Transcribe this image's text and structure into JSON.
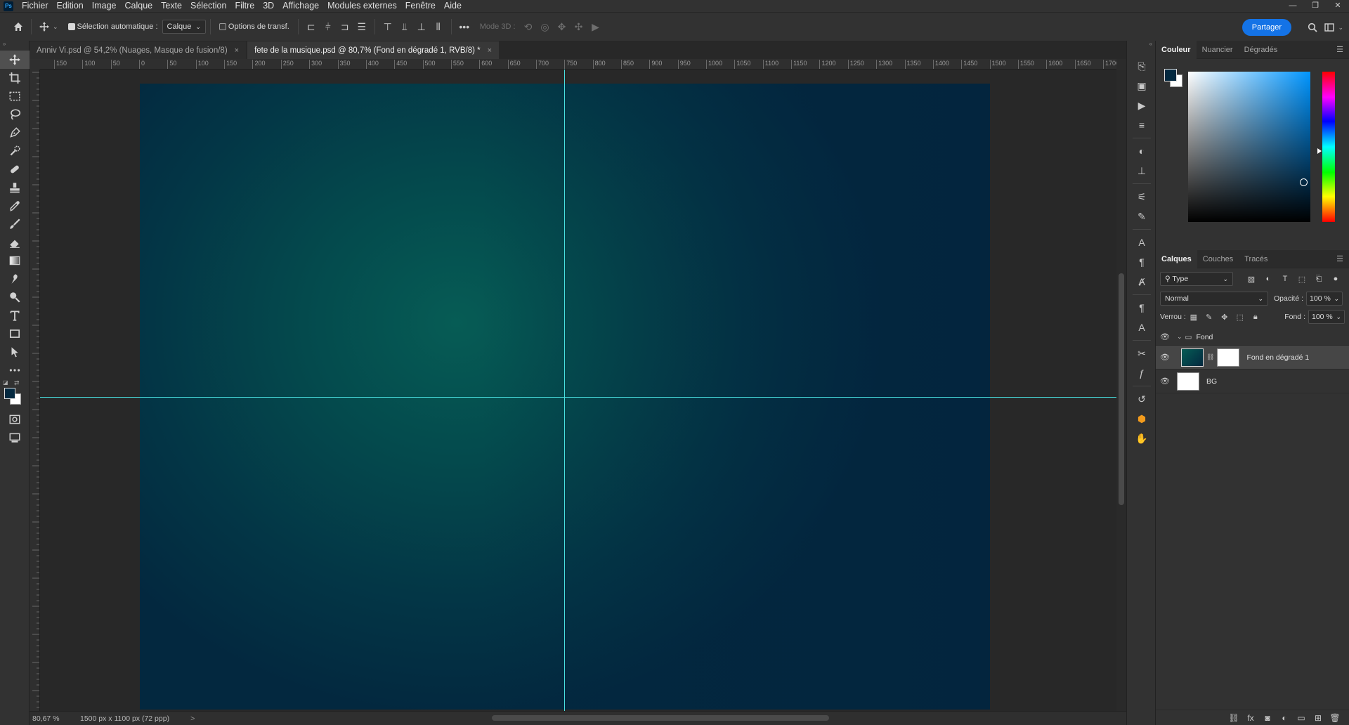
{
  "app": {
    "logo": "Ps"
  },
  "menu": [
    "Fichier",
    "Edition",
    "Image",
    "Calque",
    "Texte",
    "Sélection",
    "Filtre",
    "3D",
    "Affichage",
    "Modules externes",
    "Fenêtre",
    "Aide"
  ],
  "window_controls": {
    "minimize": "—",
    "restore": "❐",
    "close": "✕"
  },
  "options": {
    "auto_select_label": "Sélection automatique :",
    "auto_select_target": "Calque",
    "transform_label": "Options de transf.",
    "more": "•••",
    "mode3d_label": "Mode 3D :",
    "share_label": "Partager"
  },
  "tabs": [
    {
      "label": "Anniv Vi.psd @ 54,2% (Nuages, Masque de fusion/8)",
      "close": "×"
    },
    {
      "label": "fete de la musique.psd @ 80,7% (Fond en dégradé 1, RVB/8) *",
      "close": "×"
    }
  ],
  "ruler": {
    "h_labels": [
      "150",
      "100",
      "50",
      "0",
      "50",
      "100",
      "150",
      "200",
      "250",
      "300",
      "350",
      "400",
      "450",
      "500",
      "550",
      "600",
      "650",
      "700",
      "750",
      "800",
      "850",
      "900",
      "950",
      "1000",
      "1050",
      "1100",
      "1150",
      "1200",
      "1250",
      "1300",
      "1350",
      "1400",
      "1450",
      "1500",
      "1550",
      "1600",
      "1650",
      "1700"
    ]
  },
  "status": {
    "zoom": "80,67 %",
    "doc_size": "1500 px x 1100 px (72 ppp)",
    "arrow": ">"
  },
  "colors": {
    "fg": "#03283f",
    "bg": "#ffffff",
    "guide": "#49e0e0",
    "accent": "#1473e6"
  },
  "color_panel": {
    "tabs": [
      "Couleur",
      "Nuancier",
      "Dégradés"
    ]
  },
  "layers_panel": {
    "tabs": [
      "Calques",
      "Couches",
      "Tracés"
    ],
    "filter": "Type",
    "blend_mode": "Normal",
    "opacity_label": "Opacité :",
    "opacity": "100 %",
    "lock_label": "Verrou :",
    "fill_label": "Fond :",
    "fill": "100 %",
    "layers": [
      {
        "name": "Fond",
        "kind": "group"
      },
      {
        "name": "Fond en dégradé 1",
        "kind": "gradient",
        "selected": true
      },
      {
        "name": "BG",
        "kind": "fill"
      }
    ]
  }
}
